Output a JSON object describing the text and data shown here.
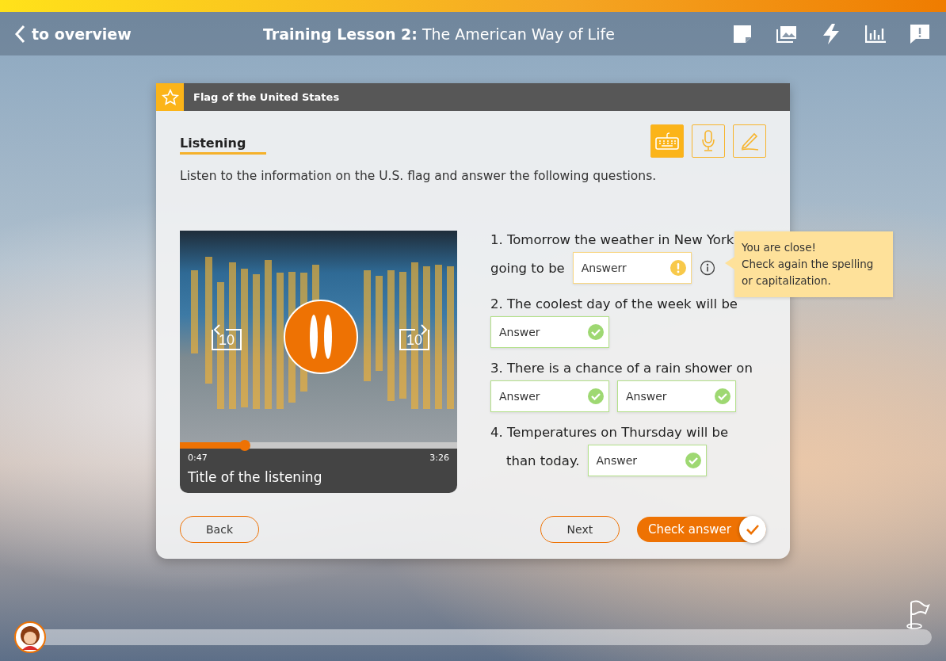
{
  "header": {
    "back_label": "to overview",
    "title_bold": "Training Lesson 2:",
    "title_rest": "The American Way of Life"
  },
  "card": {
    "title": "Flag of the United States",
    "section": "Listening",
    "instruction": "Listen to the information on the U.S. flag and answer the following questions.",
    "modes": [
      {
        "kind": "keyboard",
        "selected": true
      },
      {
        "kind": "microphone",
        "selected": false
      },
      {
        "kind": "pencil",
        "selected": false
      }
    ],
    "player": {
      "playing": true,
      "rewind_label": "10",
      "forward_label": "10",
      "level": 0.235,
      "elapsed": "0:47",
      "duration": "3:26",
      "title": "Title of the listening"
    },
    "questions": [
      {
        "prompt": "1. Tomorrow the weather in New York",
        "lead": "going to be",
        "answers": [
          {
            "value": "Answerr",
            "kind": "warning"
          }
        ],
        "hint": {
          "title": "You are close!",
          "text": "Check again the spelling or capitalization."
        }
      },
      {
        "prompt": "2. The coolest day of the week will be",
        "answers": [
          {
            "value": "Answer",
            "kind": "correct"
          }
        ]
      },
      {
        "prompt": "3. There is a chance of a rain shower on",
        "answers": [
          {
            "value": "Answer",
            "kind": "correct"
          },
          {
            "value": "Answer",
            "kind": "correct"
          }
        ]
      },
      {
        "prompt": "4. Temperatures on Thursday will be",
        "lead": "than today.",
        "answers": [
          {
            "value": "Answer",
            "kind": "correct"
          }
        ]
      }
    ],
    "buttons": {
      "back": "Back",
      "next": "Next",
      "check": "Check answer"
    }
  }
}
